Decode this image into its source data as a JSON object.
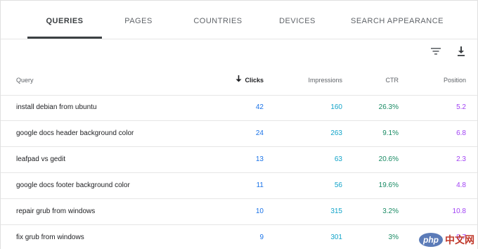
{
  "tabs": [
    {
      "label": "QUERIES"
    },
    {
      "label": "PAGES"
    },
    {
      "label": "COUNTRIES"
    },
    {
      "label": "DEVICES"
    },
    {
      "label": "SEARCH APPEARANCE"
    }
  ],
  "active_tab": "QUERIES",
  "toolbar": {
    "filter_icon": "filter-icon",
    "download_icon": "download-icon"
  },
  "table": {
    "columns": {
      "query": "Query",
      "clicks": "Clicks",
      "impressions": "Impressions",
      "ctr": "CTR",
      "position": "Position"
    },
    "sorted_by": "Clicks",
    "rows": [
      {
        "query": "install debian from ubuntu",
        "clicks": "42",
        "impressions": "160",
        "ctr": "26.3%",
        "position": "5.2"
      },
      {
        "query": "google docs header background color",
        "clicks": "24",
        "impressions": "263",
        "ctr": "9.1%",
        "position": "6.8"
      },
      {
        "query": "leafpad vs gedit",
        "clicks": "13",
        "impressions": "63",
        "ctr": "20.6%",
        "position": "2.3"
      },
      {
        "query": "google docs footer background color",
        "clicks": "11",
        "impressions": "56",
        "ctr": "19.6%",
        "position": "4.8"
      },
      {
        "query": "repair grub from windows",
        "clicks": "10",
        "impressions": "315",
        "ctr": "3.2%",
        "position": "10.8"
      },
      {
        "query": "fix grub from windows",
        "clicks": "9",
        "impressions": "301",
        "ctr": "3%",
        "position": "8.7"
      }
    ]
  },
  "colors": {
    "clicks": "#1a73e8",
    "impressions": "#12a4c9",
    "ctr": "#188a63",
    "position": "#a142f4"
  },
  "watermark": {
    "logo": "php",
    "text": "中文网"
  }
}
